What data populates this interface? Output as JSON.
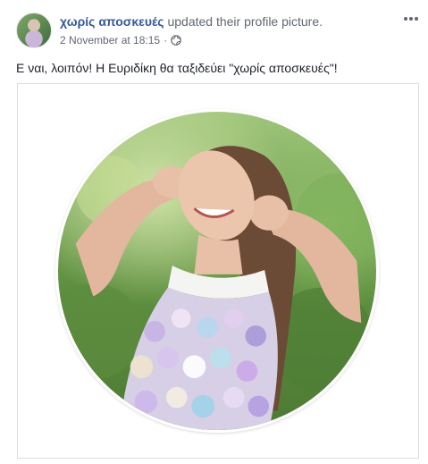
{
  "post": {
    "author": "χωρίς αποσκευές",
    "action": "updated their profile picture.",
    "date": "2 November at 18:15",
    "separator": "·",
    "privacy_icon": "globe-icon",
    "more_icon": "more-options-icon",
    "text": "Ε ναι, λοιπόν! Η Ευριδίκη θα ταξιδεύει \"χωρίς αποσκευές\"!"
  },
  "colors": {
    "author_link": "#385898",
    "secondary_text": "#616770",
    "body_text": "#1d2129",
    "border": "#dadde1"
  }
}
